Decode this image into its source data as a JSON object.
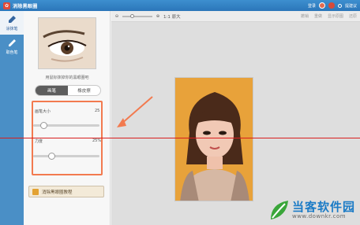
{
  "titlebar": {
    "title": "消除黑眼圈",
    "login": "登录",
    "feedback": "提建议"
  },
  "tools": [
    {
      "label": "涂抹笔"
    },
    {
      "label": "取色笔"
    }
  ],
  "panel": {
    "caption": "用鼠标抹掉你的黑眼圈吧",
    "mode_brush": "画笔",
    "mode_eraser": "橡皮擦",
    "size_label": "画笔大小",
    "size_value": "25",
    "size_fraction": 0.12,
    "strength_label": "力度",
    "strength_value": "25%",
    "strength_fraction": 0.25,
    "tutorial_label": "消除黑眼圈教程"
  },
  "toolbar": {
    "zoom_label": "1:1 原大",
    "undo": "撤销",
    "redo": "重做",
    "compare": "显示原图",
    "reset": "还原"
  },
  "watermark": {
    "brand": "当客软件园",
    "url": "www.downkr.com"
  },
  "colors": {
    "accent": "#4a8fc6",
    "highlight": "#f27a4f",
    "redline": "#d81d1d",
    "photo_bg": "#e8a23a"
  }
}
